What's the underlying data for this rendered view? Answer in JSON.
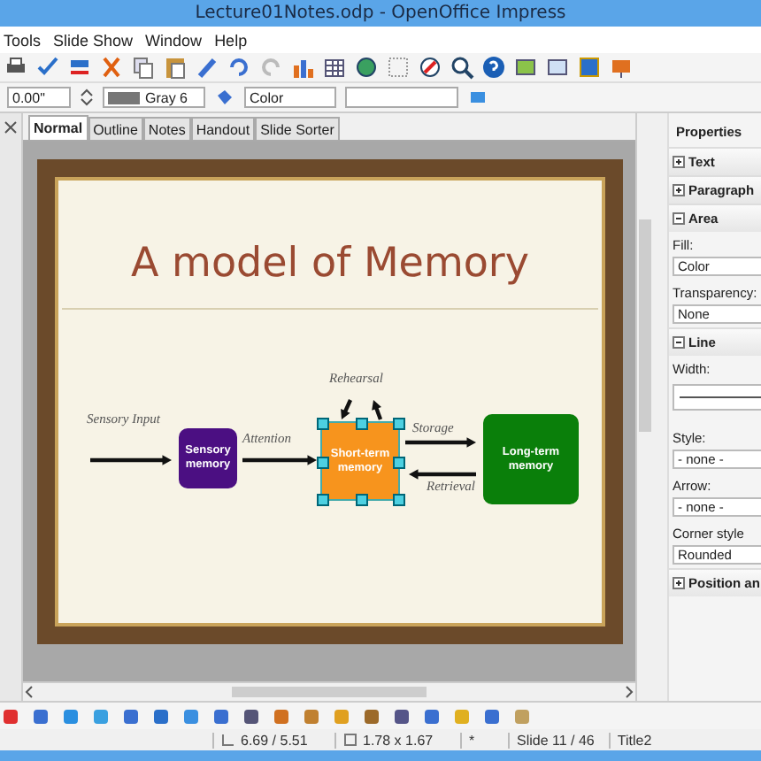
{
  "window": {
    "title": "Lecture01Notes.odp - OpenOffice Impress"
  },
  "menu": [
    "Tools",
    "Slide Show",
    "Window",
    "Help"
  ],
  "line_toolbar": {
    "angle": "0.00\"",
    "line_color": "Gray 6",
    "area_style": "Color"
  },
  "tabs": [
    {
      "label": "Normal",
      "selected": true
    },
    {
      "label": "Outline",
      "selected": false
    },
    {
      "label": "Notes",
      "selected": false
    },
    {
      "label": "Handout",
      "selected": false
    },
    {
      "label": "Slide Sorter",
      "selected": false
    }
  ],
  "slide": {
    "title": "A model of Memory",
    "boxes": [
      {
        "text": "Sensory memory",
        "color": "#4b0f82",
        "selected": false
      },
      {
        "text": "Short-term memory",
        "color": "#f7941d",
        "selected": true
      },
      {
        "text": "Long-term memory",
        "color": "#0a7f0a",
        "selected": false
      }
    ],
    "labels": [
      "Sensory Input",
      "Attention",
      "Rehearsal",
      "Storage",
      "Retrieval"
    ]
  },
  "properties": {
    "title": "Properties",
    "sections": [
      {
        "title": "Text",
        "expanded": false
      },
      {
        "title": "Paragraph",
        "expanded": false
      },
      {
        "title": "Area",
        "expanded": true,
        "fields": [
          {
            "kind": "dropdown",
            "label": "Fill:",
            "value": "Color"
          },
          {
            "kind": "dropdown",
            "label": "Transparency:",
            "value": "None"
          }
        ]
      },
      {
        "title": "Line",
        "expanded": true,
        "fields": [
          {
            "kind": "line",
            "label": "Width:"
          },
          {
            "kind": "dropdown",
            "label": "Style:",
            "value": "- none -"
          },
          {
            "kind": "dropdown",
            "label": "Arrow:",
            "value": "- none -"
          },
          {
            "kind": "dropdown",
            "label": "Corner style",
            "value": "Rounded"
          }
        ]
      },
      {
        "title": "Position an",
        "expanded": false
      }
    ]
  },
  "status_bar": {
    "position": "6.69 / 5.51",
    "size": "1.78 x 1.67",
    "modified": "*",
    "slide": "Slide 11 / 46",
    "layout": "Title2"
  }
}
